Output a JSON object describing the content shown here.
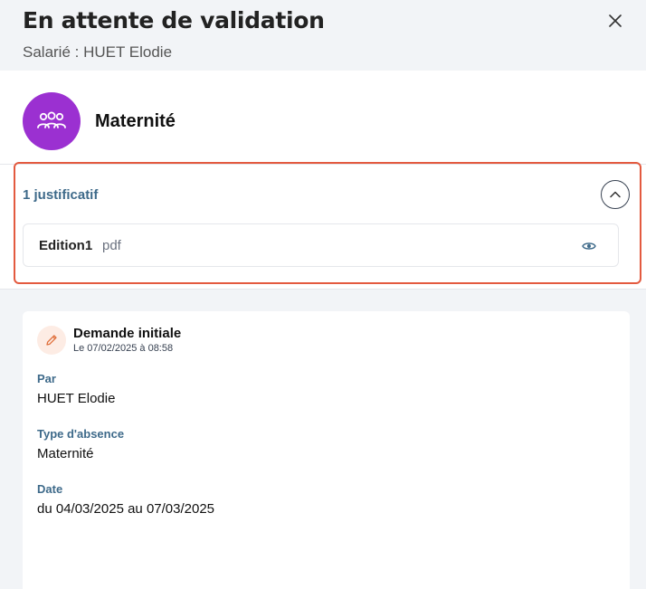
{
  "header": {
    "title": "En attente de validation",
    "subtitle": "Salarié : HUET Elodie"
  },
  "absence": {
    "type": "Maternité",
    "icon": "people-group-icon",
    "avatar_color": "#9b30d1"
  },
  "justificatifs": {
    "count_label": "1 justificatif",
    "files": [
      {
        "name": "Edition1",
        "extension": "pdf"
      }
    ]
  },
  "history": {
    "title": "Demande initiale",
    "date": "Le 07/02/2025 à 08:58",
    "fields": [
      {
        "label": "Par",
        "value": "HUET Elodie"
      },
      {
        "label": "Type d'absence",
        "value": "Maternité"
      },
      {
        "label": "Date",
        "value": "du 04/03/2025 au 07/03/2025"
      }
    ]
  },
  "colors": {
    "accent_label": "#3e6a8a",
    "highlight": "#e35a3f",
    "edit_icon": "#e0703c"
  }
}
